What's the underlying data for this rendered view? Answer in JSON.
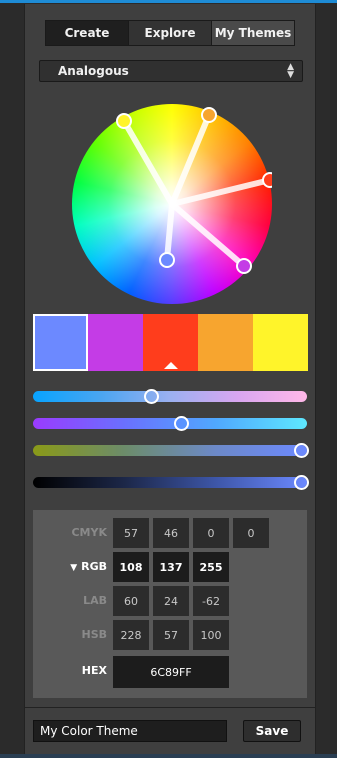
{
  "tabs": [
    {
      "label": "Create",
      "active": true
    },
    {
      "label": "Explore",
      "active": false
    },
    {
      "label": "My Themes",
      "active": false
    }
  ],
  "rule": {
    "selected": "Analogous"
  },
  "swatches": [
    {
      "color": "#6C89FF",
      "selected": true
    },
    {
      "color": "#C43CE6",
      "selected": false
    },
    {
      "color": "#FF3D1C",
      "selected": false,
      "base": true
    },
    {
      "color": "#F7A52F",
      "selected": false
    },
    {
      "color": "#FFF42A",
      "selected": false
    }
  ],
  "sliders": [
    {
      "name": "hue",
      "value_fraction": 0.43
    },
    {
      "name": "saturation",
      "value_fraction": 0.54
    },
    {
      "name": "brightness",
      "value_fraction": 1.0
    },
    {
      "name": "value",
      "value_fraction": 1.0
    }
  ],
  "values": {
    "cmyk": {
      "label": "CMYK",
      "values": [
        "57",
        "46",
        "0",
        "0"
      ]
    },
    "rgb": {
      "label": "RGB",
      "values": [
        "108",
        "137",
        "255"
      ],
      "active": true
    },
    "lab": {
      "label": "LAB",
      "values": [
        "60",
        "24",
        "-62"
      ]
    },
    "hsb": {
      "label": "HSB",
      "values": [
        "228",
        "57",
        "100"
      ]
    },
    "hex": {
      "label": "HEX",
      "value": "6C89FF"
    }
  },
  "theme": {
    "name": "My Color Theme",
    "save_label": "Save"
  }
}
